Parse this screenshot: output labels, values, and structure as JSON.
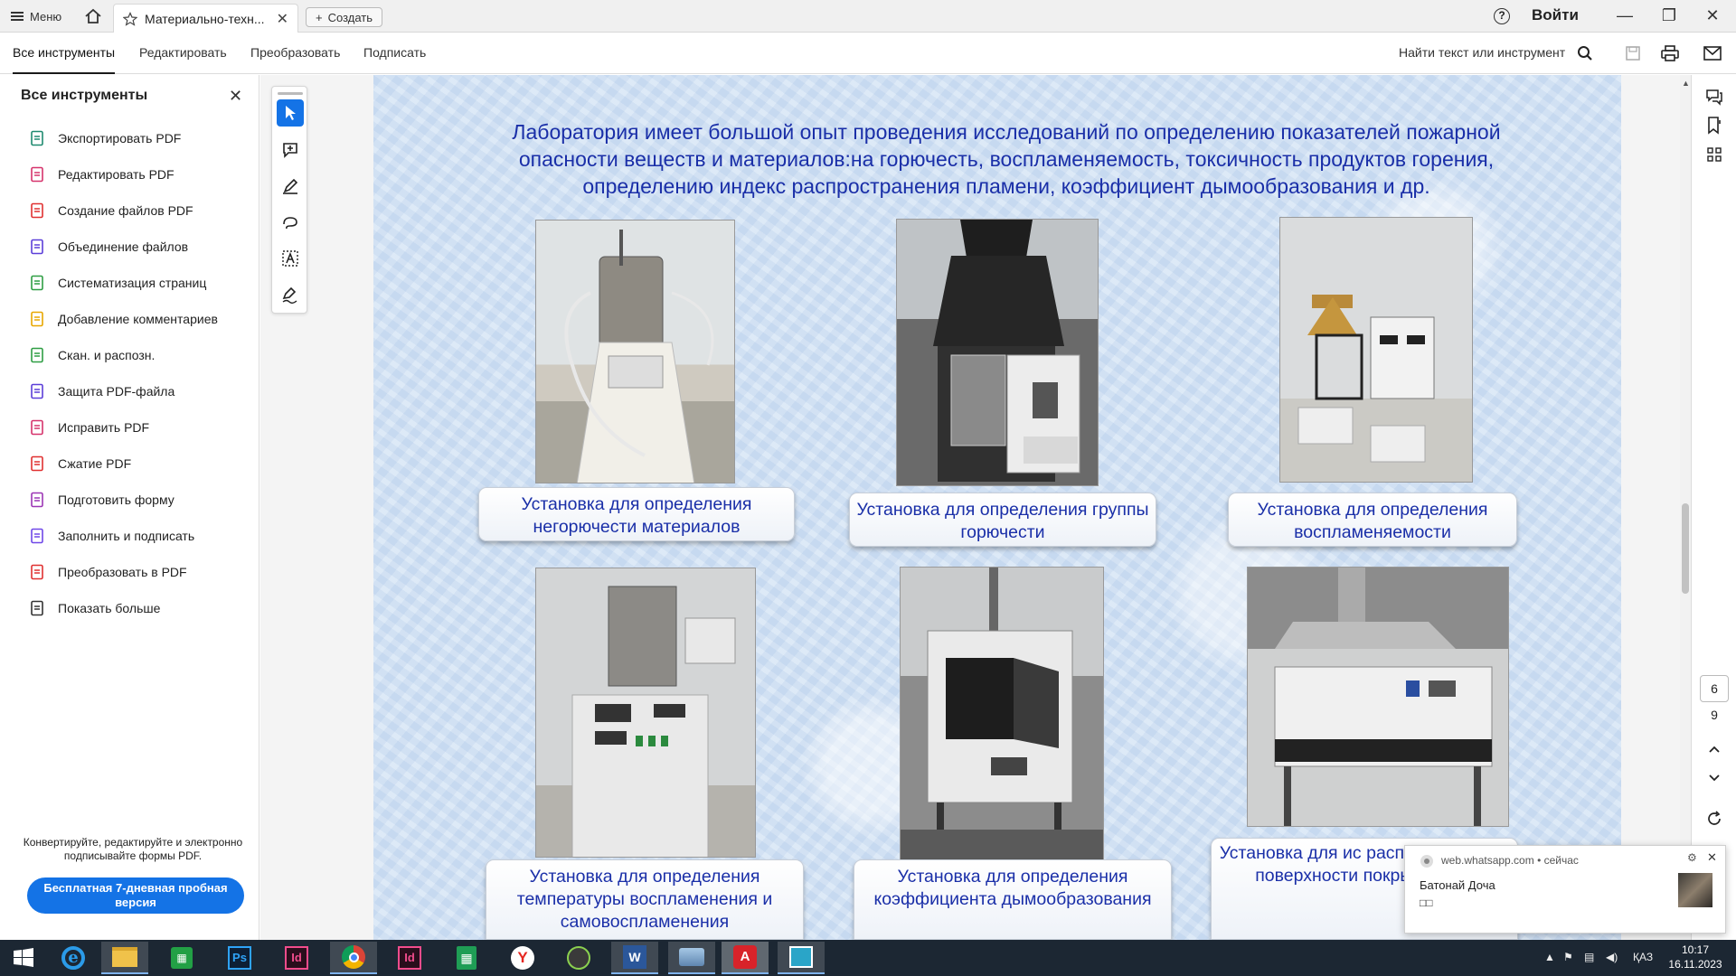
{
  "titlebar": {
    "menu_label": "Меню",
    "tab_title": "Материально-техн...",
    "create_label": "Создать",
    "signin_label": "Войти"
  },
  "toolbar": {
    "tabs": [
      "Все инструменты",
      "Редактировать",
      "Преобразовать",
      "Подписать"
    ],
    "find_label": "Найти текст или инструмент"
  },
  "left_panel": {
    "title": "Все инструменты",
    "items": [
      {
        "label": "Экспортировать PDF",
        "icon": "export-pdf-icon",
        "color": "#1f8a70"
      },
      {
        "label": "Редактировать PDF",
        "icon": "edit-pdf-icon",
        "color": "#d6336c"
      },
      {
        "label": "Создание файлов PDF",
        "icon": "create-pdf-icon",
        "color": "#e03131"
      },
      {
        "label": "Объединение файлов",
        "icon": "combine-files-icon",
        "color": "#5c3fd9"
      },
      {
        "label": "Систематизация страниц",
        "icon": "organize-pages-icon",
        "color": "#2f9e44"
      },
      {
        "label": "Добавление комментариев",
        "icon": "comment-icon",
        "color": "#e8a700"
      },
      {
        "label": "Скан. и распозн.",
        "icon": "scan-ocr-icon",
        "color": "#2f9e44"
      },
      {
        "label": "Защита PDF-файла",
        "icon": "protect-pdf-icon",
        "color": "#5c3fd9"
      },
      {
        "label": "Исправить PDF",
        "icon": "redact-pdf-icon",
        "color": "#d6336c"
      },
      {
        "label": "Сжатие PDF",
        "icon": "compress-pdf-icon",
        "color": "#e03131"
      },
      {
        "label": "Подготовить форму",
        "icon": "prepare-form-icon",
        "color": "#9c36b5"
      },
      {
        "label": "Заполнить и подписать",
        "icon": "fill-sign-icon",
        "color": "#7048e8"
      },
      {
        "label": "Преобразовать в PDF",
        "icon": "convert-pdf-icon",
        "color": "#e03131"
      },
      {
        "label": "Показать больше",
        "icon": "wrench-icon",
        "color": "#333333"
      }
    ],
    "promo_text": "Конвертируйте, редактируйте и электронно подписывайте формы PDF.",
    "trial_button": "Бесплатная 7-дневная пробная версия"
  },
  "document": {
    "heading": "Лаборатория имеет большой опыт проведения исследований по определению показателей пожарной опасности веществ и материалов:на горючесть, воспламеняемость, токсичность продуктов горения, определению индекс распространения пламени, коэффициент дымообразования и др.",
    "captions": [
      "Установка для определения негорючести материалов",
      "Установка для определения группы горючести",
      "Установка для определения воспламеняемости",
      "Установка для определения температуры воспламенения и самовоспламенения",
      "Установка для определения коэффициента дымообразования",
      "Установка для ис распространение поверхности покры кровел"
    ]
  },
  "right_rail": {
    "page_current": "6",
    "page_total": "9"
  },
  "notification": {
    "source": "web.whatsapp.com",
    "time": "сейчас",
    "sender": "Батонай Доча",
    "message": "□□"
  },
  "taskbar": {
    "language": "ҚАЗ",
    "time": "10:17",
    "date": "16.11.2023"
  }
}
